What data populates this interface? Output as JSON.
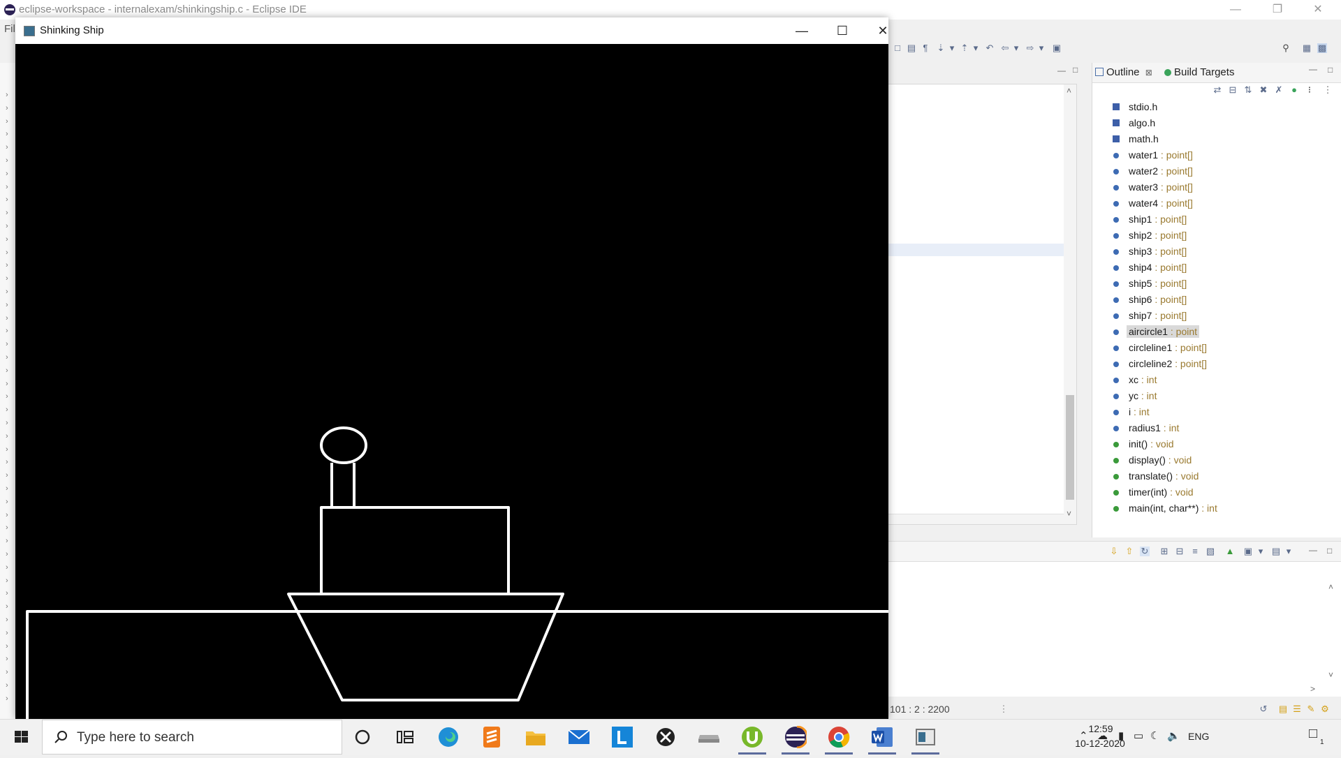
{
  "eclipse": {
    "window_title": "eclipse-workspace - internalexam/shinkingship.c - Eclipse IDE",
    "menu_file": "Fil",
    "outline": {
      "tabs": [
        {
          "label": "Outline",
          "close": "⊠"
        },
        {
          "label": "Build Targets"
        }
      ],
      "items": [
        {
          "name": "stdio.h",
          "type": "",
          "kind": "header"
        },
        {
          "name": "algo.h",
          "type": "",
          "kind": "header"
        },
        {
          "name": "math.h",
          "type": "",
          "kind": "header"
        },
        {
          "name": "water1",
          "type": " : point[]",
          "kind": "variable"
        },
        {
          "name": "water2",
          "type": " : point[]",
          "kind": "variable"
        },
        {
          "name": "water3",
          "type": " : point[]",
          "kind": "variable"
        },
        {
          "name": "water4",
          "type": " : point[]",
          "kind": "variable"
        },
        {
          "name": "ship1",
          "type": " : point[]",
          "kind": "variable"
        },
        {
          "name": "ship2",
          "type": " : point[]",
          "kind": "variable"
        },
        {
          "name": "ship3",
          "type": " : point[]",
          "kind": "variable"
        },
        {
          "name": "ship4",
          "type": " : point[]",
          "kind": "variable"
        },
        {
          "name": "ship5",
          "type": " : point[]",
          "kind": "variable"
        },
        {
          "name": "ship6",
          "type": " : point[]",
          "kind": "variable"
        },
        {
          "name": "ship7",
          "type": " : point[]",
          "kind": "variable"
        },
        {
          "name": "aircircle1",
          "type": " : point",
          "kind": "variable",
          "selected": true
        },
        {
          "name": "circleline1",
          "type": " : point[]",
          "kind": "variable"
        },
        {
          "name": "circleline2",
          "type": " : point[]",
          "kind": "variable"
        },
        {
          "name": "xc",
          "type": " : int",
          "kind": "variable"
        },
        {
          "name": "yc",
          "type": " : int",
          "kind": "variable"
        },
        {
          "name": "i",
          "type": " : int",
          "kind": "variable"
        },
        {
          "name": "radius1",
          "type": " : int",
          "kind": "variable"
        },
        {
          "name": "init()",
          "type": " : void",
          "kind": "function"
        },
        {
          "name": "display()",
          "type": " : void",
          "kind": "function"
        },
        {
          "name": "translate()",
          "type": " : void",
          "kind": "function"
        },
        {
          "name": "timer(int)",
          "type": " : void",
          "kind": "function"
        },
        {
          "name": "main(int, char**)",
          "type": " : int",
          "kind": "function"
        }
      ]
    },
    "status_bar": {
      "cursor_position": "101 : 2 : 2200"
    },
    "colors": {
      "variable_icon": "#3d6bb3",
      "function_icon": "#3a9a3a",
      "type_text": "#9a7a30"
    }
  },
  "ship_window": {
    "title": "Shinking Ship",
    "canvas_background": "#000000",
    "drawing_color": "#ffffff"
  },
  "taskbar": {
    "search_placeholder": "Type here to search",
    "apps": [
      "cortana-icon",
      "task-view-icon",
      "edge-icon",
      "sublime-text-icon",
      "file-explorer-icon",
      "mail-icon",
      "l-app-icon",
      "xbox-icon",
      "drive-icon",
      "utorrent-icon",
      "eclipse-icon",
      "chrome-icon",
      "word-icon",
      "opengl-app-icon"
    ],
    "language": "ENG",
    "time": "12:59",
    "date": "10-12-2020",
    "notification_count": "1"
  }
}
